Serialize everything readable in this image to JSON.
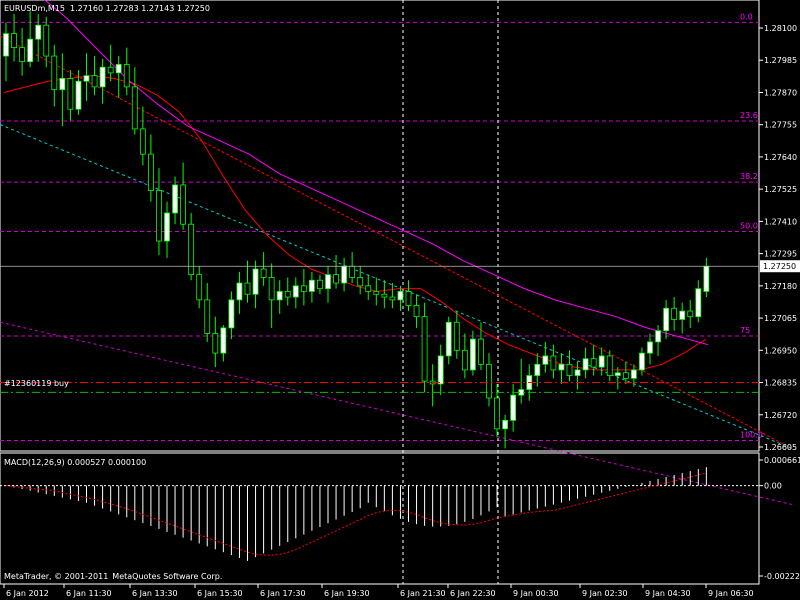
{
  "header": {
    "symbol": "EURUSDm,M15",
    "ohlc": "1.27160 1.27283 1.27143 1.27250"
  },
  "order": {
    "label": "#12360119 buy"
  },
  "copyright": "MetaQuotes Software Corp.",
  "copyright_prefix": "MetaTrader, © 2001-2011",
  "colors": {
    "background": "#000000",
    "candle": "#ffffff",
    "grid": "#ffffff",
    "fibo": "#cc00cc",
    "fibo_text": "#ff00ff",
    "ma_fast": "#ff0000",
    "ma_slow": "#ff00ff",
    "trend_red": "#ff0000",
    "trend_magenta": "#cc00cc",
    "trend_cyan": "#00cccc",
    "order_line": "#ff0000",
    "green_line": "#00c000",
    "macd_hist": "#ffffff",
    "macd_signal": "#ff0000"
  },
  "chart_data": [
    {
      "type": "candlestick",
      "title": "EURUSDm,M15",
      "ylim": [
        1.26605,
        1.2825
      ],
      "y_ticks": [
        "1.28100",
        "1.27985",
        "1.27870",
        "1.27755",
        "1.27640",
        "1.27525",
        "1.27410",
        "1.27295",
        "1.27180",
        "1.27065",
        "1.26950",
        "1.26835",
        "1.26720",
        "1.26605"
      ],
      "current_price": "1.27250",
      "x_labels": [
        "6 Jan 2012",
        "6 Jan 11:30",
        "6 Jan 13:30",
        "6 Jan 15:30",
        "6 Jan 17:30",
        "6 Jan 19:30",
        "6 Jan 21:30",
        "6 Jan 22:30",
        "9 Jan 00:30",
        "9 Jan 02:30",
        "9 Jan 04:30",
        "9 Jan 06:30"
      ],
      "fibonacci": [
        {
          "label": "0.0",
          "price": 1.2812
        },
        {
          "label": "23.6",
          "price": 1.27768
        },
        {
          "label": "38.2",
          "price": 1.2755
        },
        {
          "label": "50.0",
          "price": 1.27374
        },
        {
          "label": "75",
          "price": 1.27001
        },
        {
          "label": "100.0",
          "price": 1.26628
        }
      ],
      "order_price": 1.26835,
      "green_line_price": 1.268,
      "candles": [
        [
          1.28,
          1.2812,
          1.2791,
          1.2808
        ],
        [
          1.2808,
          1.2815,
          1.2798,
          1.2803
        ],
        [
          1.2803,
          1.281,
          1.2793,
          1.2798
        ],
        [
          1.2798,
          1.2816,
          1.2796,
          1.2806
        ],
        [
          1.2806,
          1.2815,
          1.2798,
          1.2811
        ],
        [
          1.2811,
          1.2814,
          1.2796,
          1.28
        ],
        [
          1.28,
          1.2804,
          1.2782,
          1.2788
        ],
        [
          1.2788,
          1.2801,
          1.2775,
          1.2792
        ],
        [
          1.2792,
          1.2795,
          1.2777,
          1.2781
        ],
        [
          1.2781,
          1.2795,
          1.2779,
          1.2791
        ],
        [
          1.2791,
          1.2801,
          1.2784,
          1.2793
        ],
        [
          1.2793,
          1.28,
          1.2786,
          1.2789
        ],
        [
          1.2789,
          1.2799,
          1.2783,
          1.2796
        ],
        [
          1.2796,
          1.2804,
          1.2791,
          1.2794
        ],
        [
          1.2794,
          1.28,
          1.2785,
          1.2797
        ],
        [
          1.2797,
          1.2803,
          1.2786,
          1.2789
        ],
        [
          1.2789,
          1.2796,
          1.2772,
          1.2774
        ],
        [
          1.2774,
          1.2782,
          1.2761,
          1.2765
        ],
        [
          1.2765,
          1.2772,
          1.2748,
          1.2752
        ],
        [
          1.2752,
          1.276,
          1.2729,
          1.2734
        ],
        [
          1.2734,
          1.2748,
          1.2728,
          1.2744
        ],
        [
          1.2744,
          1.2757,
          1.274,
          1.2754
        ],
        [
          1.2754,
          1.2762,
          1.2738,
          1.274
        ],
        [
          1.274,
          1.2744,
          1.272,
          1.2722
        ],
        [
          1.2722,
          1.2725,
          1.271,
          1.2713
        ],
        [
          1.2713,
          1.2719,
          1.2698,
          1.2701
        ],
        [
          1.2701,
          1.2707,
          1.2689,
          1.2694
        ],
        [
          1.2694,
          1.2704,
          1.2691,
          1.2703
        ],
        [
          1.2703,
          1.2716,
          1.2699,
          1.2713
        ],
        [
          1.2713,
          1.2723,
          1.2708,
          1.2719
        ],
        [
          1.2719,
          1.2727,
          1.2712,
          1.2715
        ],
        [
          1.2715,
          1.2727,
          1.271,
          1.2724
        ],
        [
          1.2724,
          1.273,
          1.2718,
          1.2721
        ],
        [
          1.2721,
          1.2726,
          1.2703,
          1.2713
        ],
        [
          1.2713,
          1.272,
          1.2708,
          1.2716
        ],
        [
          1.2716,
          1.2721,
          1.2711,
          1.2714
        ],
        [
          1.2714,
          1.2721,
          1.271,
          1.2718
        ],
        [
          1.2718,
          1.2724,
          1.2711,
          1.2716
        ],
        [
          1.2716,
          1.2723,
          1.2712,
          1.272
        ],
        [
          1.272,
          1.2722,
          1.2715,
          1.2717
        ],
        [
          1.2717,
          1.2725,
          1.2712,
          1.2722
        ],
        [
          1.2722,
          1.2729,
          1.2717,
          1.2719
        ],
        [
          1.2719,
          1.2728,
          1.2716,
          1.2725
        ],
        [
          1.2725,
          1.273,
          1.2719,
          1.2721
        ],
        [
          1.2721,
          1.2725,
          1.2715,
          1.2718
        ],
        [
          1.2718,
          1.2722,
          1.2713,
          1.2716
        ],
        [
          1.2716,
          1.2721,
          1.2711,
          1.2715
        ],
        [
          1.2715,
          1.272,
          1.271,
          1.2714
        ],
        [
          1.2714,
          1.2719,
          1.271,
          1.2713
        ],
        [
          1.2713,
          1.2718,
          1.2709,
          1.2716
        ],
        [
          1.2716,
          1.272,
          1.2709,
          1.2711
        ],
        [
          1.2711,
          1.2715,
          1.2703,
          1.2707
        ],
        [
          1.2707,
          1.2712,
          1.268,
          1.2684
        ],
        [
          1.2684,
          1.269,
          1.2675,
          1.2683
        ],
        [
          1.2683,
          1.2697,
          1.2679,
          1.2693
        ],
        [
          1.2693,
          1.2707,
          1.269,
          1.2705
        ],
        [
          1.2705,
          1.2709,
          1.2692,
          1.2695
        ],
        [
          1.2695,
          1.2701,
          1.2685,
          1.2688
        ],
        [
          1.2688,
          1.2702,
          1.2686,
          1.2699
        ],
        [
          1.2699,
          1.2705,
          1.2688,
          1.269
        ],
        [
          1.269,
          1.2694,
          1.2675,
          1.2678
        ],
        [
          1.2678,
          1.2683,
          1.2664,
          1.2667
        ],
        [
          1.2667,
          1.2672,
          1.266,
          1.267
        ],
        [
          1.267,
          1.2683,
          1.2666,
          1.2679
        ],
        [
          1.2679,
          1.2692,
          1.2676,
          1.2681
        ],
        [
          1.2681,
          1.269,
          1.2677,
          1.2686
        ],
        [
          1.2686,
          1.2694,
          1.2682,
          1.269
        ],
        [
          1.269,
          1.2698,
          1.2687,
          1.2693
        ],
        [
          1.2693,
          1.2697,
          1.2685,
          1.2688
        ],
        [
          1.2688,
          1.2694,
          1.2683,
          1.269
        ],
        [
          1.269,
          1.2695,
          1.2684,
          1.2686
        ],
        [
          1.2686,
          1.2691,
          1.2681,
          1.2688
        ],
        [
          1.2688,
          1.2696,
          1.2685,
          1.2692
        ],
        [
          1.2692,
          1.2697,
          1.2686,
          1.2689
        ],
        [
          1.2689,
          1.2696,
          1.2686,
          1.2693
        ],
        [
          1.2693,
          1.2695,
          1.2684,
          1.2686
        ],
        [
          1.2686,
          1.2689,
          1.2681,
          1.2687
        ],
        [
          1.2687,
          1.2691,
          1.2683,
          1.2685
        ],
        [
          1.2685,
          1.269,
          1.2682,
          1.2688
        ],
        [
          1.2688,
          1.2696,
          1.2686,
          1.2694
        ],
        [
          1.2694,
          1.2701,
          1.269,
          1.2698
        ],
        [
          1.2698,
          1.2704,
          1.2693,
          1.2702
        ],
        [
          1.2702,
          1.2713,
          1.2699,
          1.271
        ],
        [
          1.271,
          1.2714,
          1.2702,
          1.2706
        ],
        [
          1.2706,
          1.2712,
          1.2701,
          1.2709
        ],
        [
          1.2709,
          1.2713,
          1.2703,
          1.2707
        ],
        [
          1.2707,
          1.272,
          1.2705,
          1.2717
        ],
        [
          1.2716,
          1.2728,
          1.2714,
          1.2725
        ]
      ],
      "ma_fast": [
        1.2787,
        1.2789,
        1.2791,
        1.2792,
        1.2793,
        1.2792,
        1.279,
        1.2786,
        1.278,
        1.277,
        1.2757,
        1.2745,
        1.2736,
        1.2729,
        1.2724,
        1.2721,
        1.2718,
        1.2716,
        1.2717,
        1.2717,
        1.2712,
        1.2706,
        1.2701,
        1.2697,
        1.2694,
        1.2691,
        1.2689,
        1.2688,
        1.2688,
        1.2688,
        1.269,
        1.2694,
        1.2699
      ],
      "ma_slow": [
        1.283,
        1.2823,
        1.2814,
        1.2803,
        1.2792,
        1.2783,
        1.2775,
        1.277,
        1.2765,
        1.2758,
        1.2753,
        1.2748,
        1.2743,
        1.2738,
        1.2733,
        1.2727,
        1.2722,
        1.2717,
        1.2713,
        1.271,
        1.2707,
        1.2703,
        1.27,
        1.2697
      ],
      "trend_lines": [
        {
          "name": "red",
          "from": [
            1.28,
            2
          ],
          "to": [
            1.266,
            99
          ]
        },
        {
          "name": "magenta",
          "from": [
            1.273,
            2
          ],
          "to": [
            1.264,
            99
          ]
        },
        {
          "name": "cyan",
          "from": [
            1.2772,
            2
          ],
          "to": [
            1.266,
            99
          ]
        }
      ]
    },
    {
      "type": "macd",
      "label": "MACD(12,26,9) 0.000527 0.000100",
      "ylim": [
        -0.0027,
        0.00075
      ],
      "y_ticks": [
        "0.000661",
        "0.00",
        "-0.002227"
      ],
      "histogram_trend": "starts near 0, drops to about -0.0022 near 6 Jan 15:30, recovers toward 0, dips again around 6 Jan 22:30, then rises above 0 by 9 Jan 06:30"
    }
  ]
}
